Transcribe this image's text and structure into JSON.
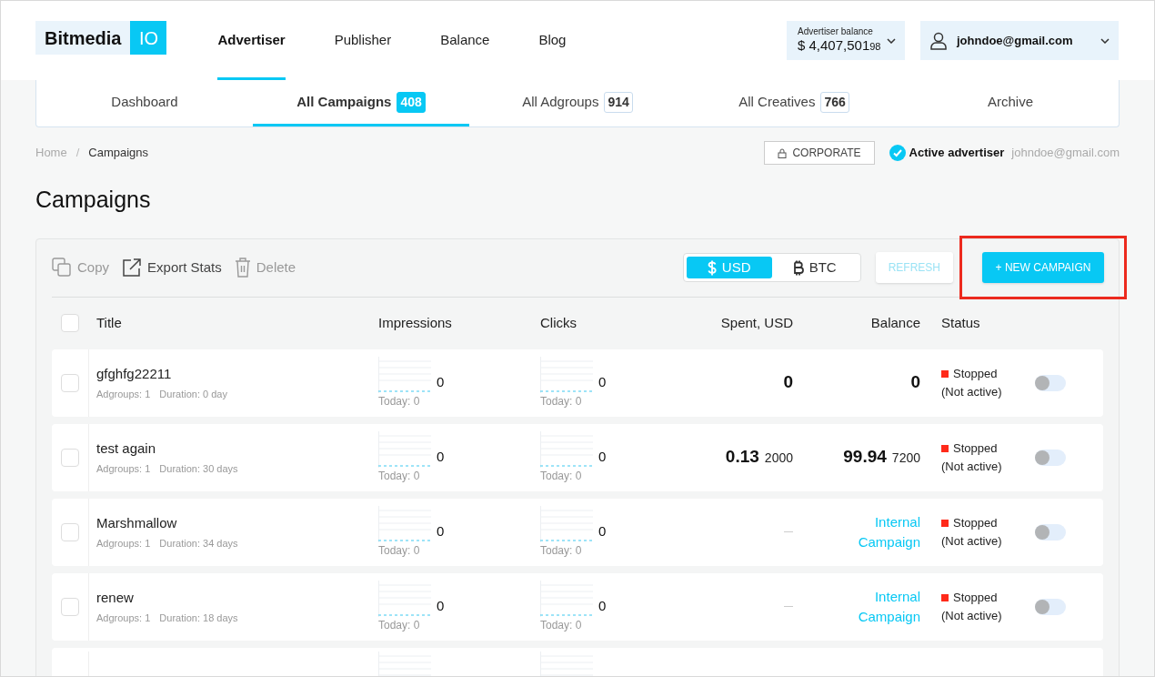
{
  "header": {
    "logo": {
      "word": "Bitmedia",
      "tag": "IO"
    },
    "nav": [
      {
        "label": "Advertiser",
        "selected": true
      },
      {
        "label": "Publisher",
        "selected": false
      },
      {
        "label": "Balance",
        "selected": false
      },
      {
        "label": "Blog",
        "selected": false
      }
    ],
    "balance": {
      "label": "Advertiser balance",
      "amount": "$ 4,407,501",
      "cents": "98"
    },
    "user": {
      "email": "johndoe@gmail.com"
    }
  },
  "subtabs": [
    {
      "label": "Dashboard",
      "selected": false
    },
    {
      "label": "All Campaigns",
      "count": "408",
      "selected": true
    },
    {
      "label": "All Adgroups",
      "count": "914",
      "selected": false
    },
    {
      "label": "All Creatives",
      "count": "766",
      "selected": false
    },
    {
      "label": "Archive",
      "selected": false
    }
  ],
  "breadcrumb": {
    "items": [
      "Home",
      "Campaigns"
    ],
    "separator": "/"
  },
  "account": {
    "corporate": "CORPORATE",
    "active_label": "Active advertiser",
    "email": "johndoe@gmail.com"
  },
  "page_title": "Campaigns",
  "toolbar": {
    "actions": [
      {
        "label": "Copy",
        "kind": "copy",
        "disabled": true
      },
      {
        "label": "Export Stats",
        "kind": "export",
        "disabled": false
      },
      {
        "label": "Delete",
        "kind": "delete",
        "disabled": true
      }
    ],
    "currency": [
      {
        "label": "USD",
        "kind": "usd",
        "selected": true
      },
      {
        "label": "BTC",
        "kind": "btc",
        "selected": false
      }
    ],
    "refresh": "REFRESH",
    "new_campaign": "+ NEW CAMPAIGN"
  },
  "table": {
    "select_all_checked": false,
    "columns": [
      "Title",
      "Impressions",
      "Clicks",
      "Spent, USD",
      "Balance",
      "Status"
    ],
    "rows": [
      {
        "title": "gfghfg22211",
        "adgroups": "Adgroups: 1",
        "duration": "Duration: 0 day",
        "impressions": "0",
        "impressions_today": "Today: 0",
        "clicks": "0",
        "clicks_today": "Today: 0",
        "spent": {
          "kind": "amount",
          "main": "0"
        },
        "balance": {
          "kind": "amount",
          "main": "0"
        },
        "status": "Stopped",
        "status_note": "(Not active)",
        "color": "#ff2a1a",
        "on": false,
        "checked": false
      },
      {
        "title": "test again",
        "adgroups": "Adgroups: 1",
        "duration": "Duration: 30 days",
        "impressions": "0",
        "impressions_today": "Today: 0",
        "clicks": "0",
        "clicks_today": "Today: 0",
        "spent": {
          "kind": "amount",
          "main": "0.13",
          "sub": "2000"
        },
        "balance": {
          "kind": "amount",
          "main": "99.94",
          "sub": "7200"
        },
        "status": "Stopped",
        "status_note": "(Not active)",
        "color": "#ff2a1a",
        "on": false,
        "checked": false
      },
      {
        "title": "Marshmallow",
        "adgroups": "Adgroups: 1",
        "duration": "Duration: 34 days",
        "impressions": "0",
        "impressions_today": "Today: 0",
        "clicks": "0",
        "clicks_today": "Today: 0",
        "spent": {
          "kind": "none"
        },
        "balance": {
          "kind": "link",
          "text": "Internal Campaign"
        },
        "status": "Stopped",
        "status_note": "(Not active)",
        "color": "#ff2a1a",
        "on": false,
        "checked": false
      },
      {
        "title": "renew",
        "adgroups": "Adgroups: 1",
        "duration": "Duration: 18 days",
        "impressions": "0",
        "impressions_today": "Today: 0",
        "clicks": "0",
        "clicks_today": "Today: 0",
        "spent": {
          "kind": "none"
        },
        "balance": {
          "kind": "link",
          "text": "Internal Campaign"
        },
        "status": "Stopped",
        "status_note": "(Not active)",
        "color": "#ff2a1a",
        "on": false,
        "checked": false
      }
    ]
  }
}
